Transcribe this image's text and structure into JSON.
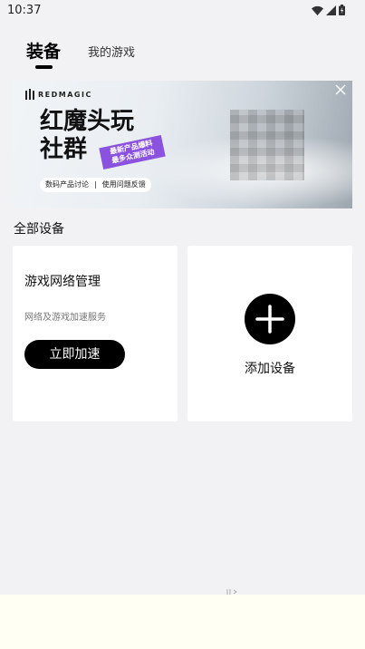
{
  "status_bar": {
    "time": "10:37",
    "icons": [
      "wifi-icon",
      "signal-icon",
      "battery-icon"
    ]
  },
  "tabs": [
    {
      "label": "装备",
      "active": true
    },
    {
      "label": "我的游戏",
      "active": false
    }
  ],
  "banner": {
    "brand": "REDMAGIC",
    "title_line1": "红魔头玩",
    "title_line2": "社群",
    "promo_line1": "最新产品爆料",
    "promo_line2": "最多众测活动",
    "chip_left": "数码产品讨论",
    "chip_sep": "|",
    "chip_right": "使用问题反馈",
    "accent_color": "#8b52e0"
  },
  "section": {
    "title": "全部设备"
  },
  "cards": {
    "network": {
      "title": "游戏网络管理",
      "subtitle": "网络及游戏加速服务",
      "button": "立即加速"
    },
    "add_device": {
      "label": "添加设备"
    }
  },
  "colors": {
    "background": "#f2f2f5",
    "card": "#ffffff",
    "primary": "#000000",
    "bottom_area": "#fffff3"
  }
}
